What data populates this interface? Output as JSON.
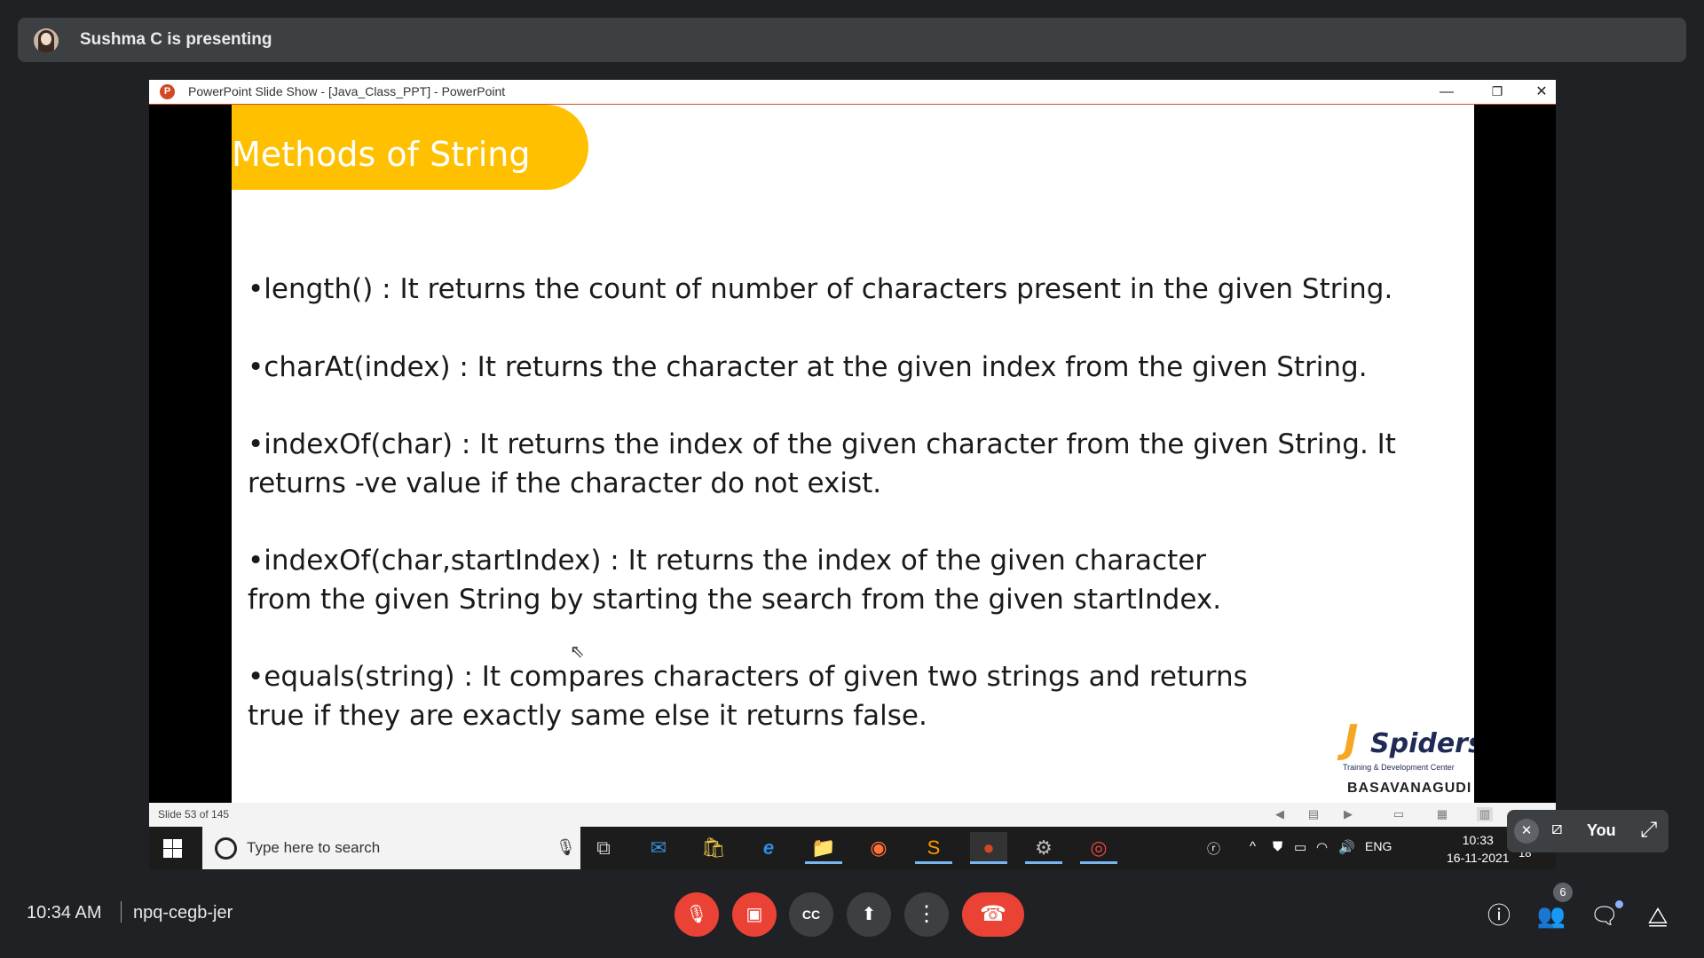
{
  "presenter": {
    "text": "Sushma C is presenting"
  },
  "window": {
    "app_icon": "P",
    "title": "PowerPoint Slide Show - [Java_Class_PPT] - PowerPoint",
    "buttons": {
      "minimize": "—",
      "restore": "❐",
      "close": "✕"
    }
  },
  "slide": {
    "title": "Methods of String",
    "bullets": [
      {
        "lines": [
          "•length() : It returns the count of number of characters present in the given String."
        ]
      },
      {
        "lines": [
          "•charAt(index)  : It returns the character at the given index from the given String."
        ]
      },
      {
        "lines": [
          "•indexOf(char)  : It returns the index of the given character from the given String. It",
          " returns -ve value if the character do not exist."
        ]
      },
      {
        "lines": [
          "•indexOf(char,startIndex)  : It returns the index of the given character",
          "from the given String by starting the search from the given startIndex."
        ]
      },
      {
        "lines": [
          "•equals(string) : It compares characters of given two strings and returns",
          "true if they are exactly same else it returns false."
        ]
      }
    ],
    "logo": {
      "mark": "J",
      "word": "Spiders",
      "tagline": "Training & Development Center",
      "branch": "BASAVANAGUDI"
    }
  },
  "statusbar": {
    "slide_counter": "Slide 53 of 145"
  },
  "taskbar": {
    "search_placeholder": "Type here to search",
    "tray": {
      "language": "ENG",
      "time": "10:33",
      "date": "16-11-2021",
      "notification_count": "18"
    }
  },
  "self_view": {
    "name": "You"
  },
  "meet": {
    "time": "10:34 AM",
    "separator": "|",
    "meeting_code": "npq-cegb-jer",
    "participant_count": "6"
  },
  "colors": {
    "title_banner": "#ffc000",
    "end_call": "#ea4335",
    "background": "#202124"
  }
}
